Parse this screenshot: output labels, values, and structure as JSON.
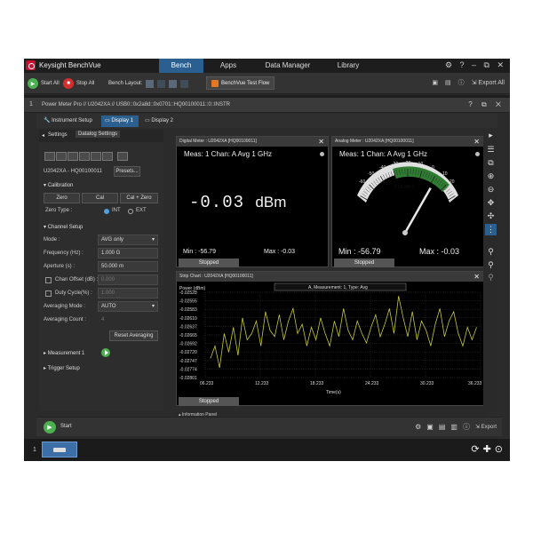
{
  "app": {
    "title": "Keysight BenchVue",
    "nav_tabs": [
      "Bench",
      "Apps",
      "Data Manager",
      "Library"
    ],
    "active_nav": "Bench",
    "window_icons": "⚙ ? – ⧉ ✕"
  },
  "toolbar": {
    "start_all": "Start All",
    "stop_all": "Stop All",
    "bench_layout": "Bench Layout:",
    "test_flow": "BenchVue Test Flow",
    "export_all": "Export All"
  },
  "instrument": {
    "number": "1",
    "title": "Power Meter Pro // U2042XA // USB0::0x2a8d::0x0701::HQ00100011::0::INSTR",
    "tabs": [
      "Instrument Setup",
      "Display 1",
      "Display 2"
    ]
  },
  "left_panel": {
    "tabs": [
      "Settings",
      "Datalog Settings"
    ],
    "device": "U2042XA - HQ00100011",
    "presets": "Presets...",
    "calibration": {
      "heading": "Calibration",
      "zero": "Zero",
      "cal": "Cal",
      "cal_zero": "Cal + Zero",
      "zero_type": "Zero Type :",
      "int": "INT",
      "ext": "EXT"
    },
    "channel_setup": {
      "heading": "Channel Setup",
      "mode_label": "Mode :",
      "mode_value": "AVG only",
      "freq_label": "Frequency (Hz) :",
      "freq_value": "1.000 G",
      "aperture_label": "Aperture (s) :",
      "aperture_value": "50.000 m",
      "chan_offset_label": "Chan Offset (dB) :",
      "chan_offset_value": "0.000",
      "duty_label": "Duty Cycle(%) :",
      "duty_value": "1.000",
      "avg_mode_label": "Averaging Mode :",
      "avg_mode_value": "AUTO",
      "avg_count_label": "Averaging Count :",
      "avg_count_value": "4",
      "reset_avg": "Reset Averaging"
    },
    "measurement": "Measurement 1",
    "trigger": "Trigger Setup"
  },
  "digital_meter": {
    "title": "Digital Meter : U2042XA [HQ00100011]",
    "meas": "Meas: 1  Chan: A  Avg  1 GHz",
    "value": "-0.03",
    "unit": "dBm",
    "min": "Min : -56.79",
    "max": "Max : -0.03",
    "status": "Stopped"
  },
  "analog_meter": {
    "title": "Analog Meter : U2042XA [HQ00100011]",
    "meas": "Meas: 1  Chan: A  Avg  1 GHz",
    "reading": "-0.03 dBm",
    "scale": [
      "-60",
      "-50",
      "-40",
      "-30",
      "-20",
      "-10",
      "0",
      "10",
      "20"
    ],
    "needle_value": -0.03,
    "min": "Min : -56.79",
    "max": "Max : -0.03",
    "status": "Stopped"
  },
  "strip_chart": {
    "title": "Strip Chart : U2042XA [HQ00100011]",
    "legend": "A, Measurement: 1, Type: Avg",
    "status": "Stopped"
  },
  "chart_data": {
    "type": "line",
    "title": "",
    "ylabel": "Power (dBm)",
    "xlabel": "Time(s)",
    "ylim": [
      -0.02801,
      -0.02528
    ],
    "xlim": [
      6.233,
      36.233
    ],
    "x_ticks": [
      "06.233",
      "12.233",
      "18.233",
      "24.233",
      "30.233",
      "36.233"
    ],
    "y_ticks": [
      "-0.02528",
      "-0.02555",
      "-0.02583",
      "-0.02610",
      "-0.02637",
      "-0.02665",
      "-0.02692",
      "-0.02720",
      "-0.02747",
      "-0.02774",
      "-0.02801"
    ],
    "series": [
      {
        "color": "#c8c83a",
        "x": [
          6.8,
          7.3,
          7.8,
          8.3,
          8.8,
          9.3,
          9.8,
          10.3,
          10.8,
          11.3,
          11.8,
          12.3,
          12.8,
          13.3,
          13.8,
          14.3,
          14.8,
          15.3,
          15.8,
          16.3,
          16.8,
          17.3,
          17.8,
          18.3,
          18.8,
          19.3,
          19.8,
          20.3,
          20.8,
          21.3,
          21.8,
          22.3,
          22.8,
          23.3,
          23.8,
          24.3,
          24.8,
          25.3,
          25.8,
          26.3,
          26.8,
          27.3,
          27.8,
          28.3,
          28.8,
          29.3,
          29.8,
          30.3,
          30.8,
          31.3,
          31.8,
          32.3,
          32.8,
          33.3,
          33.8,
          34.3,
          34.8,
          35.3,
          35.8
        ],
        "y": [
          -0.0274,
          -0.027,
          -0.0277,
          -0.0266,
          -0.0272,
          -0.0264,
          -0.0273,
          -0.0261,
          -0.0268,
          -0.0266,
          -0.0262,
          -0.027,
          -0.0259,
          -0.0265,
          -0.0267,
          -0.026,
          -0.0268,
          -0.0262,
          -0.0258,
          -0.0266,
          -0.0263,
          -0.027,
          -0.0264,
          -0.0268,
          -0.0261,
          -0.0266,
          -0.027,
          -0.0262,
          -0.0267,
          -0.0258,
          -0.0265,
          -0.0268,
          -0.0262,
          -0.0266,
          -0.0269,
          -0.0264,
          -0.026,
          -0.0267,
          -0.0263,
          -0.0258,
          -0.0266,
          -0.0254,
          -0.0261,
          -0.0267,
          -0.0259,
          -0.0268,
          -0.0262,
          -0.0265,
          -0.027,
          -0.0263,
          -0.0258,
          -0.0267,
          -0.0262,
          -0.0259,
          -0.0266,
          -0.027,
          -0.0264,
          -0.0268,
          -0.0264
        ]
      }
    ]
  },
  "info_panel": "Information Panel",
  "bottom": {
    "start": "Start",
    "export": "Export"
  },
  "taskbar": {
    "number": "1"
  }
}
